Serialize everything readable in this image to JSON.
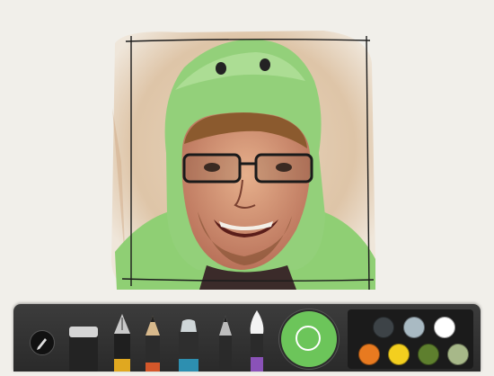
{
  "app": {
    "accent": "#6cc55a"
  },
  "canvas": {
    "background": "#f1efea",
    "subject": "sketch-portrait"
  },
  "toolbar": {
    "tools": [
      {
        "name": "pen-toggle",
        "icon": "pencil-icon"
      },
      {
        "name": "eraser",
        "icon": "eraser-icon"
      },
      {
        "name": "fountain-pen",
        "icon": "fountain-pen-icon"
      },
      {
        "name": "pencil",
        "icon": "pencil-tool-icon"
      },
      {
        "name": "marker",
        "icon": "marker-icon"
      },
      {
        "name": "fine-pencil",
        "icon": "fine-pencil-icon"
      },
      {
        "name": "brush",
        "icon": "brush-icon"
      }
    ],
    "current_color": "#6cc55a",
    "palette": [
      {
        "name": "dark-slate",
        "color": "#3d4347"
      },
      {
        "name": "blue-gray",
        "color": "#a9bac3"
      },
      {
        "name": "white",
        "color": "#ffffff"
      },
      {
        "name": "orange",
        "color": "#e87a20"
      },
      {
        "name": "yellow",
        "color": "#f3cf1f"
      },
      {
        "name": "olive-green",
        "color": "#5e7f2e"
      },
      {
        "name": "sage",
        "color": "#a7b889"
      }
    ]
  }
}
